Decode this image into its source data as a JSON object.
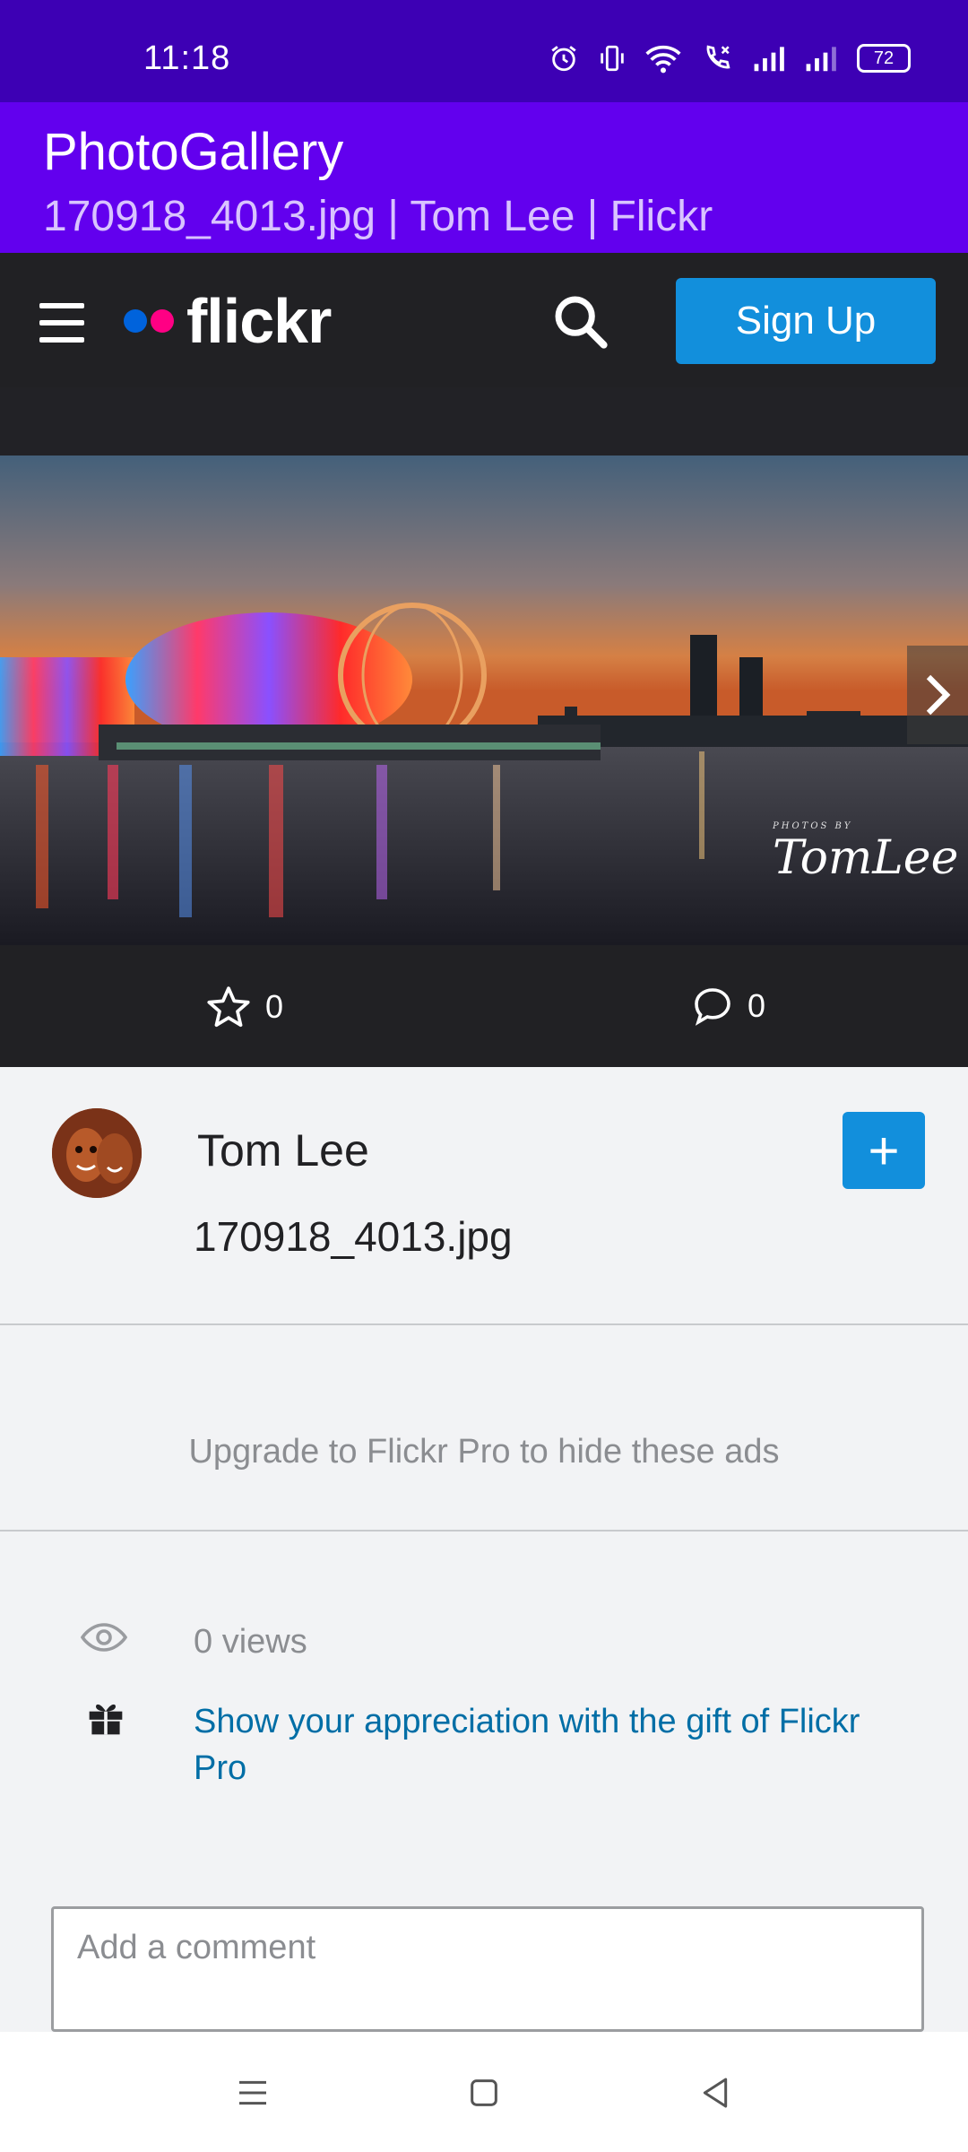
{
  "status_bar": {
    "time": "11:18",
    "battery": "72",
    "icons": [
      "alarm-icon",
      "vibrate-icon",
      "wifi-icon",
      "call-icon",
      "signal-icon",
      "signal-icon"
    ]
  },
  "app_bar": {
    "title": "PhotoGallery",
    "subtitle": "170918_4013.jpg | Tom Lee | Flickr"
  },
  "flickr_header": {
    "logo_text": "flickr",
    "signup_label": "Sign Up",
    "colors": {
      "blue_dot": "#0063dc",
      "pink_dot": "#ff0084",
      "signup_bg": "#128fdc"
    }
  },
  "photo": {
    "signature_small": "PHOTOS BY",
    "signature": "TomLee"
  },
  "stats": {
    "favorites": "0",
    "comments": "0"
  },
  "owner": {
    "name": "Tom Lee",
    "photo_title": "170918_4013.jpg",
    "follow_label": "+"
  },
  "ads": {
    "upgrade_text": "Upgrade to Flickr Pro to hide these ads"
  },
  "details": {
    "views": "0 views",
    "gift_text": "Show your appreciation with the gift of Flickr Pro"
  },
  "comment": {
    "placeholder": "Add a comment"
  }
}
